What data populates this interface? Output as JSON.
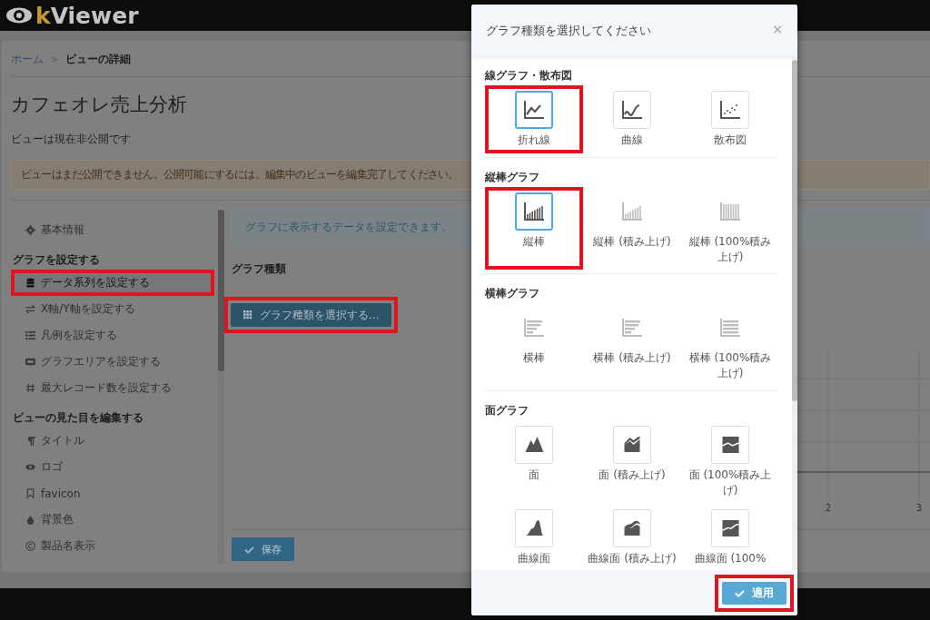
{
  "app": {
    "logo_k": "k",
    "logo_rest": "Viewer"
  },
  "breadcrumb": [
    {
      "label": "ホーム",
      "link": true
    },
    {
      "label": "ビューの詳細",
      "link": false
    }
  ],
  "breadcrumb_separator": ">",
  "page_title": "カフェオレ売上分析",
  "status_text": "ビューは現在非公開です",
  "alert": "ビューはまだ公開できません。公開可能にするには、編集中のビューを編集完了してください。",
  "sidebar": {
    "items": [
      {
        "kind": "item",
        "label": "基本情報",
        "selected": false,
        "highlighted": false
      },
      {
        "kind": "heading",
        "label": "グラフを設定する"
      },
      {
        "kind": "item",
        "label": "データ系列を設定する",
        "selected": true,
        "highlighted": true
      },
      {
        "kind": "item",
        "label": "X軸/Y軸を設定する",
        "selected": false,
        "highlighted": false
      },
      {
        "kind": "item",
        "label": "凡例を設定する",
        "selected": false,
        "highlighted": false
      },
      {
        "kind": "item",
        "label": "グラフエリアを設定する",
        "selected": false,
        "highlighted": false
      },
      {
        "kind": "item",
        "label": "最大レコード数を設定する",
        "selected": false,
        "highlighted": false
      },
      {
        "kind": "heading",
        "label": "ビューの見た目を編集する"
      },
      {
        "kind": "item",
        "label": "タイトル",
        "selected": false,
        "highlighted": false
      },
      {
        "kind": "item",
        "label": "ロゴ",
        "selected": false,
        "highlighted": false
      },
      {
        "kind": "item",
        "label": "favicon",
        "selected": false,
        "highlighted": false
      },
      {
        "kind": "item",
        "label": "背景色",
        "selected": false,
        "highlighted": false
      },
      {
        "kind": "item",
        "label": "製品名表示",
        "selected": false,
        "highlighted": false
      }
    ]
  },
  "content": {
    "info": "グラフに表示するデータを設定できます。",
    "field_label": "グラフ種類",
    "select_button": {
      "label": "グラフ種類を選択する...",
      "highlighted": true
    },
    "chart_axis_labels": [
      "2",
      "3"
    ],
    "save_button": "保存"
  },
  "modal": {
    "title": "グラフ種類を選択してください",
    "close": "×",
    "sections": [
      {
        "title": "線グラフ・散布図",
        "options": [
          {
            "kind": "line",
            "label": "折れ線",
            "selected": true,
            "disabled": false,
            "highlighted": true
          },
          {
            "kind": "curve",
            "label": "曲線",
            "selected": false,
            "disabled": false,
            "highlighted": false
          },
          {
            "kind": "scatter",
            "label": "散布図",
            "selected": false,
            "disabled": false,
            "highlighted": false
          }
        ]
      },
      {
        "title": "縦棒グラフ",
        "options": [
          {
            "kind": "bar",
            "label": "縦棒",
            "selected": true,
            "disabled": false,
            "highlighted": true
          },
          {
            "kind": "bar",
            "label": "縦棒 (積み上げ)",
            "selected": false,
            "disabled": true,
            "highlighted": false
          },
          {
            "kind": "bar100",
            "label": "縦棒 (100%積み上げ)",
            "selected": false,
            "disabled": true,
            "highlighted": false
          }
        ]
      },
      {
        "title": "横棒グラフ",
        "options": [
          {
            "kind": "hbar",
            "label": "横棒",
            "selected": false,
            "disabled": true,
            "highlighted": false
          },
          {
            "kind": "hbar2",
            "label": "横棒 (積み上げ)",
            "selected": false,
            "disabled": true,
            "highlighted": false
          },
          {
            "kind": "hbar3",
            "label": "横棒 (100%積み上げ)",
            "selected": false,
            "disabled": true,
            "highlighted": false
          }
        ]
      },
      {
        "title": "面グラフ",
        "options": [
          {
            "kind": "area",
            "label": "面",
            "selected": false,
            "disabled": false,
            "highlighted": false
          },
          {
            "kind": "area2",
            "label": "面 (積み上げ)",
            "selected": false,
            "disabled": false,
            "highlighted": false
          },
          {
            "kind": "area3",
            "label": "面 (100%積み上げ)",
            "selected": false,
            "disabled": false,
            "highlighted": false
          },
          {
            "kind": "spline",
            "label": "曲線面",
            "selected": false,
            "disabled": false,
            "highlighted": false
          },
          {
            "kind": "spline2",
            "label": "曲線面 (積み上げ)",
            "selected": false,
            "disabled": false,
            "highlighted": false
          },
          {
            "kind": "spline3",
            "label": "曲線面 (100%",
            "selected": false,
            "disabled": false,
            "highlighted": false
          }
        ]
      }
    ],
    "apply_button": {
      "label": "適用",
      "highlighted": true
    }
  }
}
